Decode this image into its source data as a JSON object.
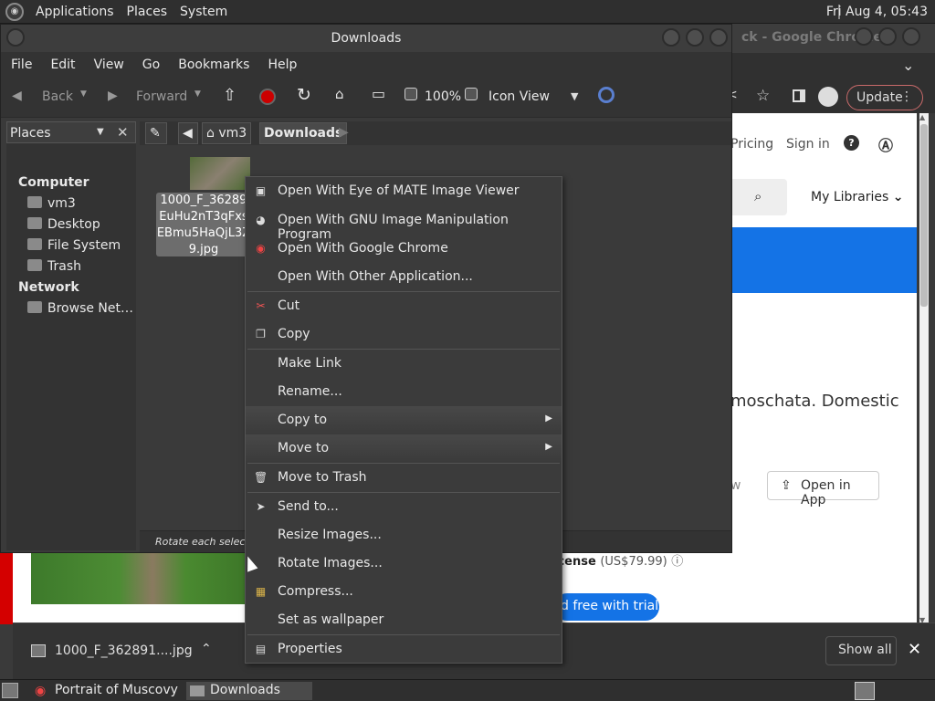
{
  "top_panel": {
    "menus": [
      "Applications",
      "Places",
      "System"
    ],
    "clock": "Fri Aug  4, 05:43"
  },
  "chrome": {
    "title": "ck - Google Chrome",
    "update_label": "Update",
    "page": {
      "nav_pricing": "Pricing",
      "nav_signin": "Sign in",
      "my_libraries": "My Libraries",
      "body_text": "moschata. Domestic",
      "view_fragment": "w",
      "open_in_app": "Open in App",
      "license_label": "icense",
      "license_price": "(US$79.99)",
      "trial_label": "d free with trial"
    },
    "download_bar": {
      "file": "1000_F_362891....jpg",
      "show_all": "Show all"
    }
  },
  "file_manager": {
    "title": "Downloads",
    "menus": [
      "File",
      "Edit",
      "View",
      "Go",
      "Bookmarks",
      "Help"
    ],
    "toolbar": {
      "back": "Back",
      "forward": "Forward",
      "zoom": "100%",
      "view_mode": "Icon View"
    },
    "sidebar": {
      "header": "Places",
      "computer_label": "Computer",
      "computer_items": [
        "vm3",
        "Desktop",
        "File System",
        "Trash"
      ],
      "network_label": "Network",
      "network_items": [
        "Browse Net…"
      ]
    },
    "pathbar": [
      "vm3",
      "Downloads"
    ],
    "file": {
      "name_lines": [
        "1000_F_36289",
        "EuHu2nT3qFxs",
        "EBmu5HaQjL3Z",
        "9.jpg"
      ]
    },
    "status": "Rotate each selected"
  },
  "context_menu": {
    "items": [
      {
        "label": "Open With Eye of MATE Image Viewer",
        "icon": "image-viewer-icon"
      },
      {
        "label": "Open With GNU Image Manipulation Program",
        "icon": "gimp-icon"
      },
      {
        "label": "Open With Google Chrome",
        "icon": "chrome-icon"
      },
      {
        "label": "Open With Other Application...",
        "icon": ""
      },
      {
        "label": "Cut",
        "icon": "scissors-icon"
      },
      {
        "label": "Copy",
        "icon": "copy-icon"
      },
      {
        "label": "Make Link",
        "icon": ""
      },
      {
        "label": "Rename...",
        "icon": ""
      },
      {
        "label": "Copy to",
        "icon": "",
        "submenu": true
      },
      {
        "label": "Move to",
        "icon": "",
        "submenu": true
      },
      {
        "label": "Move to Trash",
        "icon": "trash-icon"
      },
      {
        "label": "Send to...",
        "icon": "send-icon"
      },
      {
        "label": "Resize Images...",
        "icon": ""
      },
      {
        "label": "Rotate Images...",
        "icon": ""
      },
      {
        "label": "Compress...",
        "icon": "archive-icon"
      },
      {
        "label": "Set as wallpaper",
        "icon": ""
      },
      {
        "label": "Properties",
        "icon": "properties-icon"
      }
    ]
  },
  "taskbar": {
    "tasks": [
      "Portrait of Muscovy ...",
      "Downloads"
    ]
  }
}
